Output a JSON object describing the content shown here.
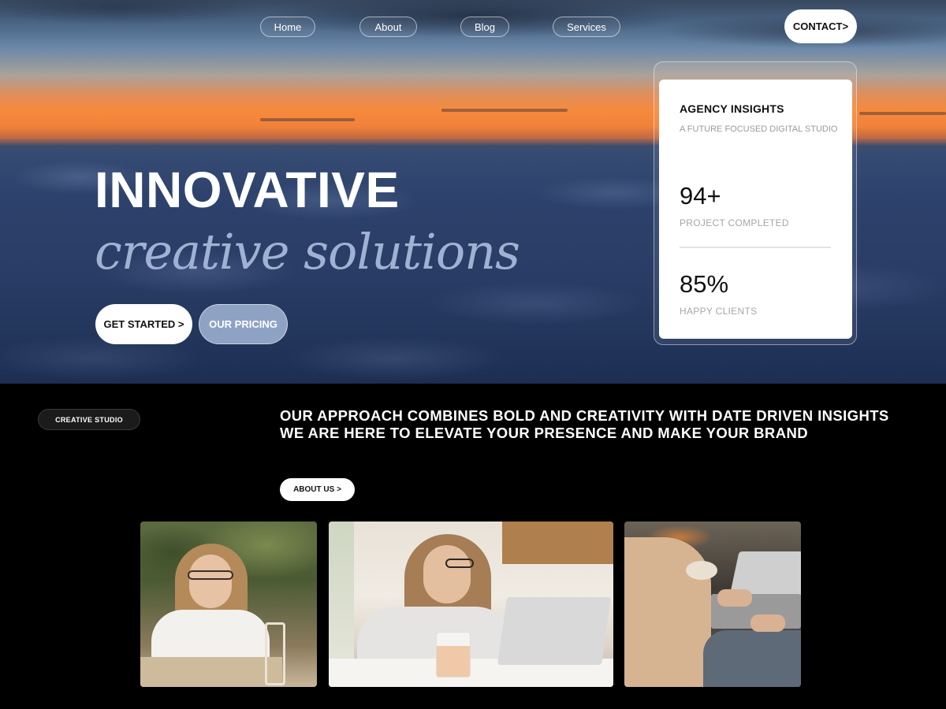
{
  "nav": {
    "items": [
      "Home",
      "About",
      "Blog",
      "Services"
    ],
    "contact_label": "CONTACT>"
  },
  "hero": {
    "headline_line1": "INNOVATIVE",
    "headline_line2": "creative solutions",
    "get_started_label": "GET STARTED >",
    "pricing_label": "OUR PRICING"
  },
  "insights_card": {
    "title": "AGENCY INSIGHTS",
    "subtitle": "A FUTURE FOCUSED DIGITAL STUDIO",
    "stats": [
      {
        "value": "94+",
        "label": "PROJECT COMPLETED"
      },
      {
        "value": "85%",
        "label": "HAPPY CLIENTS"
      }
    ]
  },
  "studio": {
    "badge": "CREATIVE STUDIO",
    "approach": "OUR APPROACH COMBINES BOLD AND CREATIVITY WITH DATE DRIVEN INSIGHTS WE ARE HERE TO ELEVATE YOUR PRESENCE AND MAKE YOUR BRAND",
    "about_label": "ABOUT US >"
  },
  "colors": {
    "accent_blue": "#8ea2c4",
    "headline_italic": "#9fb2d3",
    "background_dark": "#000000"
  }
}
